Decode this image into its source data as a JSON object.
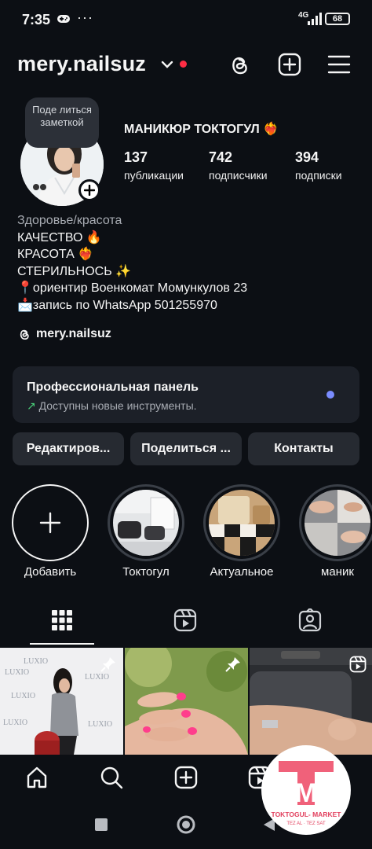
{
  "status_bar": {
    "time": "7:35",
    "dots": "···",
    "network": "4G",
    "battery": "68"
  },
  "header": {
    "username": "mery.nailsuz",
    "icons": [
      "threads-icon",
      "new-post-icon",
      "menu-icon"
    ],
    "notification_color": "#ff2d44"
  },
  "profile": {
    "note": "Поде литься заметкой",
    "full_name": "МАНИКЮР ТОКТОГУЛ ❤️‍🔥",
    "stats": [
      {
        "value": "137",
        "label": "публикации"
      },
      {
        "value": "742",
        "label": "подписчики"
      },
      {
        "value": "394",
        "label": "подписки"
      }
    ],
    "category": "Здоровье/красота",
    "bio_lines": [
      "КАЧЕСТВО 🔥",
      "КРАСОТА ❤️‍🔥",
      "СТЕРИЛЬНОСЬ ✨",
      "📍ориентир Военкомат Момункулов 23",
      "📩запись по  WhatsApp  501255970"
    ],
    "threads_handle": "mery.nailsuz"
  },
  "pro_panel": {
    "title": "Профессиональная панель",
    "arrow": "↗",
    "subtitle": "Доступны новые инструменты.",
    "dot_color": "#7a8cff"
  },
  "actions": {
    "edit": "Редактиров...",
    "share": "Поделиться ...",
    "contacts": "Контакты"
  },
  "highlights": [
    {
      "label": "Добавить"
    },
    {
      "label": "Токтогул"
    },
    {
      "label": "Актуальное"
    },
    {
      "label": "маник"
    }
  ],
  "tabs": [
    "grid-icon",
    "reels-icon",
    "tagged-icon"
  ],
  "grid": {
    "banner_text": "LUXIO"
  },
  "bottom_nav": [
    "home-icon",
    "search-icon",
    "create-icon",
    "reels-icon",
    "profile-icon"
  ],
  "watermark": {
    "letter": "M",
    "line1": "TOKTOGUL- MARKET",
    "line2": "TEZ AL · TEZ SAT",
    "color": "#f0617a"
  }
}
